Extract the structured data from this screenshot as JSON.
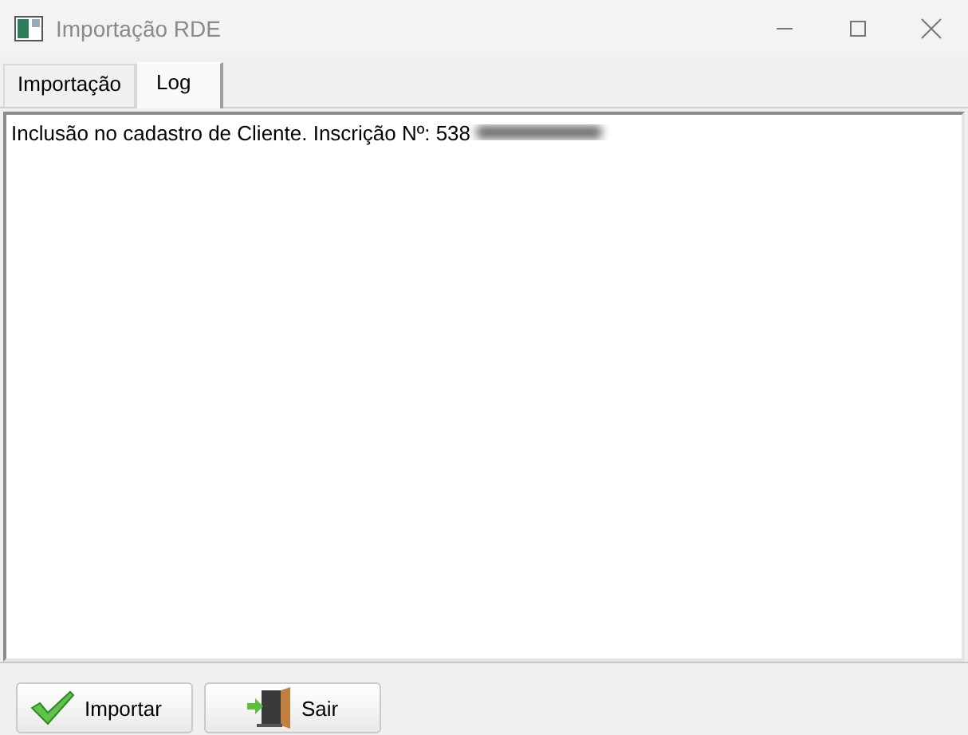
{
  "window": {
    "title": "Importação RDE"
  },
  "tabs": [
    {
      "label": "Importação",
      "selected": false
    },
    {
      "label": "Log",
      "selected": true
    }
  ],
  "log": {
    "lines": [
      "Inclusão no cadastro de Cliente. Inscrição Nº: 538"
    ]
  },
  "buttons": [
    {
      "label": "Importar",
      "kind": "import"
    },
    {
      "label": "Sair",
      "kind": "exit"
    }
  ]
}
